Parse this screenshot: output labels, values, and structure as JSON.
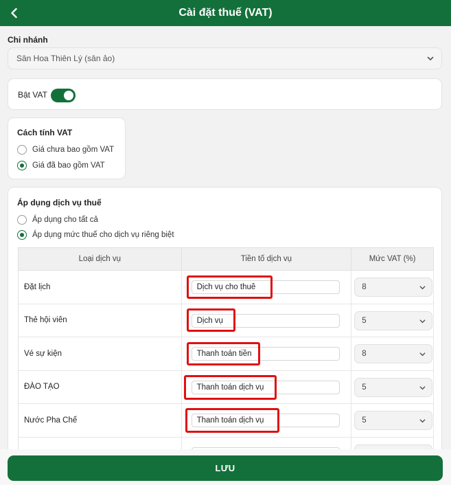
{
  "header": {
    "title": "Cài đặt thuế (VAT)",
    "back_icon": "chevron-left-icon"
  },
  "branch": {
    "label": "Chi nhánh",
    "selected": "Sân Hoa Thiên Lý (sân ảo)"
  },
  "vat_toggle": {
    "label": "Bật VAT",
    "enabled": true
  },
  "calc_method": {
    "title": "Cách tính VAT",
    "options": [
      {
        "label": "Giá chưa bao gồm VAT",
        "selected": false
      },
      {
        "label": "Giá đã bao gồm VAT",
        "selected": true
      }
    ]
  },
  "apply": {
    "title": "Áp dụng dịch vụ thuế",
    "options": [
      {
        "label": "Áp dụng cho tất cả",
        "selected": false
      },
      {
        "label": "Áp dụng mức thuế cho dịch vụ riêng biệt",
        "selected": true
      }
    ],
    "columns": [
      "Loại dịch vụ",
      "Tiền tố dịch vụ",
      "Mức VAT (%)"
    ],
    "rows": [
      {
        "service": "Đặt lịch",
        "prefix": "Dịch vụ cho thuê",
        "vat": "8"
      },
      {
        "service": "Thẻ hội viên",
        "prefix": "Dịch vụ",
        "vat": "5"
      },
      {
        "service": "Vé sự kiện",
        "prefix": "Thanh toán tiền",
        "vat": "8"
      },
      {
        "service": "ĐÀO TẠO",
        "prefix": "Thanh toán dịch vụ",
        "vat": "5"
      },
      {
        "service": "Nước Pha Chế",
        "prefix": "Thanh toán dịch vụ",
        "vat": "5"
      },
      {
        "service": "",
        "prefix": "",
        "vat": ""
      }
    ]
  },
  "save_button": "LƯU",
  "colors": {
    "primary": "#13703b",
    "highlight": "#e01010"
  }
}
